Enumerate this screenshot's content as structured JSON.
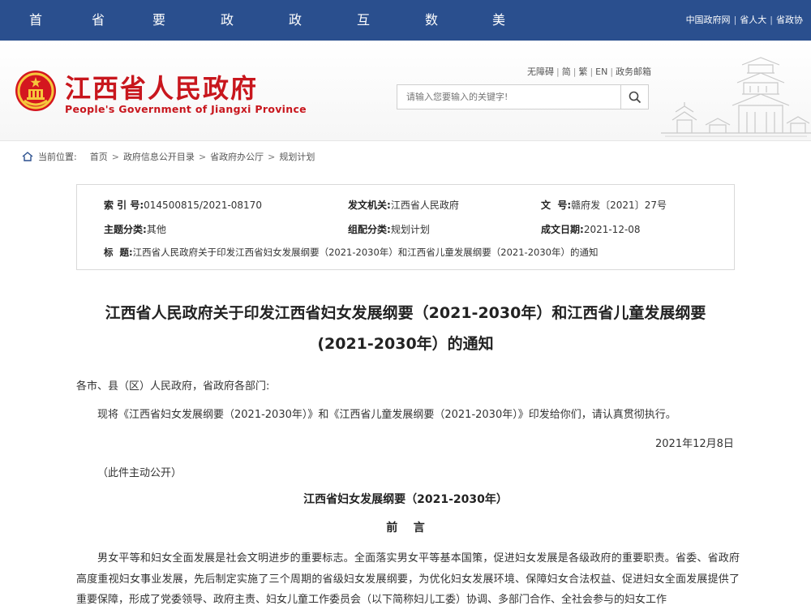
{
  "nav": {
    "items": [
      "首页",
      "省政府",
      "要闻动态",
      "政务公开",
      "政务服务",
      "互动交流",
      "数据开放",
      "美丽江西"
    ],
    "quick_links": [
      "中国政府网",
      "省人大",
      "省政协"
    ]
  },
  "header": {
    "site_name": "江西省人民政府",
    "site_name_en": "People's Government of Jiangxi Province",
    "links": [
      "无障碍",
      "简",
      "繁",
      "EN",
      "政务邮箱"
    ],
    "search_placeholder": "请输入您要输入的关键字!"
  },
  "breadcrumb": {
    "label": "当前位置:",
    "items": [
      "首页",
      "政府信息公开目录",
      "省政府办公厅",
      "规划计划"
    ]
  },
  "meta": {
    "index_label": "索 引 号:",
    "index_value": "014500815/2021-08170",
    "issuer_label": "发文机关:",
    "issuer_value": "江西省人民政府",
    "docno_label": "文  号:",
    "docno_value": "赣府发〔2021〕27号",
    "category_label": "主题分类:",
    "category_value": "其他",
    "group_label": "组配分类:",
    "group_value": "规划计划",
    "date_label": "成文日期:",
    "date_value": "2021-12-08",
    "title_label": "标  题:",
    "title_value": "江西省人民政府关于印发江西省妇女发展纲要（2021-2030年）和江西省儿童发展纲要（2021-2030年）的通知"
  },
  "document": {
    "title_line1": "江西省人民政府关于印发江西省妇女发展纲要（2021-2030年）和江西省儿童发展纲要",
    "title_line2": "(2021-2030年）的通知",
    "salutation": "各市、县（区）人民政府，省政府各部门:",
    "body1": "现将《江西省妇女发展纲要（2021-2030年）》和《江西省儿童发展纲要（2021-2030年）》印发给你们，请认真贯彻执行。",
    "date": "2021年12月8日",
    "disclosure": "（此件主动公开）",
    "section_title": "江西省妇女发展纲要（2021-2030年）",
    "preface": "前    言",
    "preface_text": "男女平等和妇女全面发展是社会文明进步的重要标志。全面落实男女平等基本国策，促进妇女发展是各级政府的重要职责。省委、省政府高度重视妇女事业发展，先后制定实施了三个周期的省级妇女发展纲要，为优化妇女发展环境、保障妇女合法权益、促进妇女全面发展提供了重要保障，形成了党委领导、政府主责、妇女儿童工作委员会（以下简称妇儿工委）协调、多部门合作、全社会参与的妇女工作"
  }
}
